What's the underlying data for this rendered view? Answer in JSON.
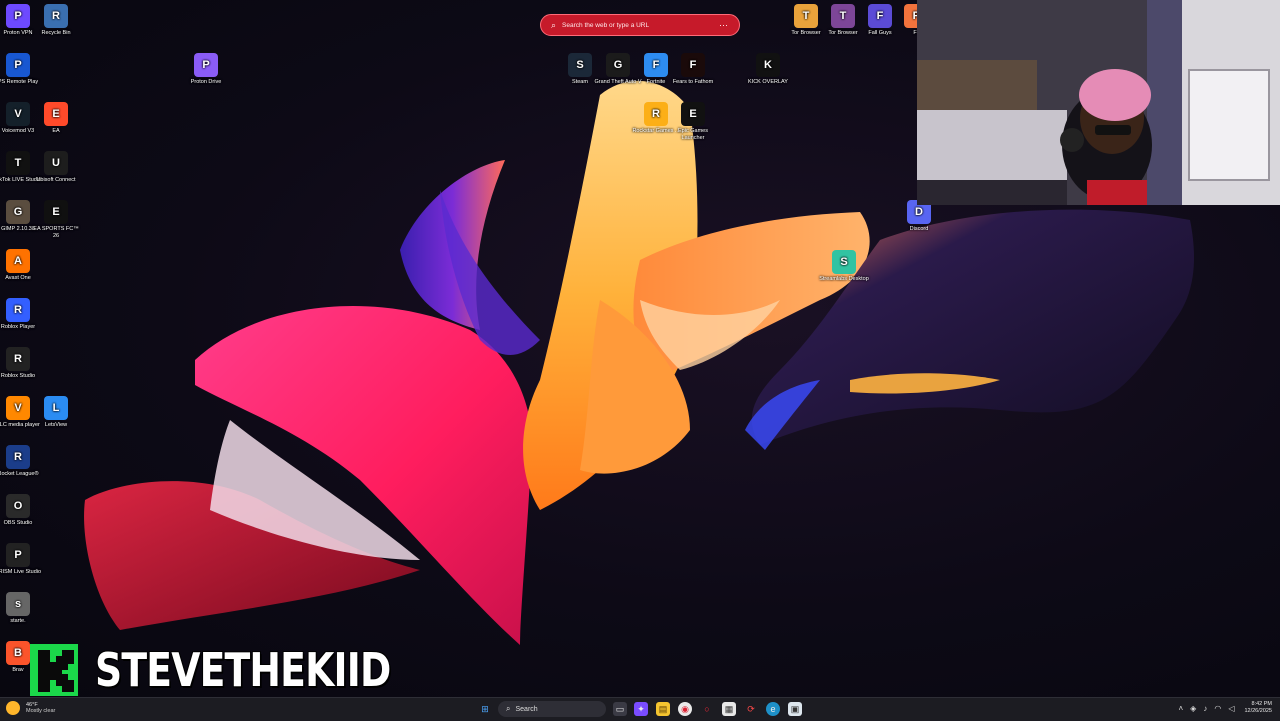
{
  "browser_search": {
    "placeholder": "Search the web or type a URL"
  },
  "desktop_icons_left": [
    {
      "label": "Proton VPN",
      "icon": "proton-vpn-icon",
      "color": "#6d4aff"
    },
    {
      "label": "Recycle Bin",
      "icon": "recycle-bin-icon",
      "color": "#3a6fb0"
    },
    {
      "label": "PS Remote Play",
      "icon": "ps-remote-play-icon",
      "color": "#1857d1"
    },
    {
      "label": "Voicemod V3",
      "icon": "voicemod-icon",
      "color": "#14202a"
    },
    {
      "label": "EA",
      "icon": "ea-icon",
      "color": "#ff4a2a"
    },
    {
      "label": "TikTok LIVE Studio",
      "icon": "tiktok-live-studio-icon",
      "color": "#111111"
    },
    {
      "label": "Ubisoft Connect",
      "icon": "ubisoft-connect-icon",
      "color": "#1d1d1d"
    },
    {
      "label": "GIMP 2.10.38",
      "icon": "gimp-icon",
      "color": "#5a4d3f"
    },
    {
      "label": "EA SPORTS FC™ 26",
      "icon": "ea-sports-fc-icon",
      "color": "#101010"
    },
    {
      "label": "Avast One",
      "icon": "avast-one-icon",
      "color": "#ff7200"
    },
    {
      "label": "Roblox Player",
      "icon": "roblox-player-icon",
      "color": "#335fff"
    },
    {
      "label": "Roblox Studio",
      "icon": "roblox-studio-icon",
      "color": "#222222"
    },
    {
      "label": "VLC media player",
      "icon": "vlc-icon",
      "color": "#ff8800"
    },
    {
      "label": "LetsView",
      "icon": "letsview-icon",
      "color": "#2b8cf2"
    },
    {
      "label": "Rocket League®",
      "icon": "rocket-league-icon",
      "color": "#1b3d8a"
    },
    {
      "label": "OBS Studio",
      "icon": "obs-studio-icon",
      "color": "#2a2a2a"
    },
    {
      "label": "PRISM Live Studio",
      "icon": "prism-live-studio-icon",
      "color": "#222222"
    },
    {
      "label": "starte.",
      "icon": "shortcut-icon",
      "color": "#666666"
    },
    {
      "label": "Brav",
      "icon": "brave-icon",
      "color": "#fb542b"
    }
  ],
  "desktop_icons_top": [
    {
      "label": "Proton Drive",
      "icon": "proton-drive-icon",
      "color": "#8a5cf6"
    },
    {
      "label": "Steam",
      "icon": "steam-icon",
      "color": "#1b2838"
    },
    {
      "label": "Grand Theft Auto V",
      "icon": "gta-v-icon",
      "color": "#1b1b1b"
    },
    {
      "label": "Fortnite",
      "icon": "fortnite-icon",
      "color": "#2d8cf0"
    },
    {
      "label": "Fears to Fathom",
      "icon": "fears-to-fathom-icon",
      "color": "#1a0a0a"
    },
    {
      "label": "Rockstar Games ...",
      "icon": "rockstar-games-icon",
      "color": "#fcaf17"
    },
    {
      "label": "Epic Games Launcher",
      "icon": "epic-games-icon",
      "color": "#111111"
    },
    {
      "label": "KICK OVERLAY",
      "icon": "kick-overlay-icon",
      "color": "#111111"
    },
    {
      "label": "Tor Browser",
      "icon": "tor-browser-icon",
      "color": "#e9a23b"
    },
    {
      "label": "Tor Browser",
      "icon": "tor-browser-icon",
      "color": "#7d4698"
    },
    {
      "label": "Fall Guys",
      "icon": "fall-guys-icon",
      "color": "#5b4bd6"
    },
    {
      "label": "Fr",
      "icon": "shortcut-icon",
      "color": "#f2733d"
    },
    {
      "label": "Streamlabs Desktop",
      "icon": "streamlabs-icon",
      "color": "#31c3a2"
    },
    {
      "label": "Discord",
      "icon": "discord-icon",
      "color": "#5865f2"
    }
  ],
  "overlay": {
    "channel_name": "STEVETHEKIID",
    "logo": "kick-logo-icon",
    "logo_color": "#1bd84a"
  },
  "taskbar": {
    "weather_temp": "46°F",
    "weather_desc": "Mostly clear",
    "search_label": "Search",
    "time": "8:42 PM",
    "date": "12/26/2025",
    "pinned_icons": [
      "windows-start-icon",
      "task-view-icon",
      "copilot-icon",
      "file-explorer-icon",
      "chrome-icon",
      "opera-gx-icon",
      "microsoft-store-icon",
      "vpn-icon",
      "edge-icon",
      "app-icon"
    ]
  }
}
